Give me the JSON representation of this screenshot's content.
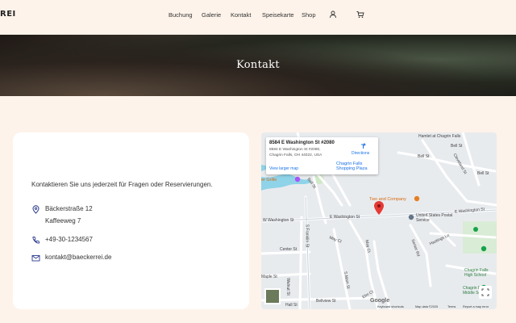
{
  "nav": {
    "brand": "REI",
    "items": [
      "Buchung",
      "Galerie",
      "Kontakt",
      "Speisekarte",
      "Shop"
    ],
    "user_icon": "user-icon",
    "cart_icon": "cart-icon"
  },
  "hero": {
    "title": "Kontakt"
  },
  "contact": {
    "intro": "Kontaktieren Sie uns jederzeit für Fragen oder Reservierungen.",
    "address_line1": "Bäckerstraße 12",
    "address_line2": "Kaffeeweg 7",
    "phone": "+49-30-1234567",
    "email": "kontakt@baeckerrei.de"
  },
  "map": {
    "info_title": "8584 E Washington St #2080",
    "info_addr1": "8584 E Washington St #2080,",
    "info_addr2": "Chagrin Falls, OH 44022, USA",
    "directions": "Directions",
    "view_larger": "View larger map",
    "labels": {
      "hamlet": "Hamlet at Chagrin Falls",
      "bell_st_top": "Bell St",
      "bell_st_right": "Bell St",
      "bell_st_left": "Bell St",
      "cleveland_st": "Cleveland St",
      "grille": "er Grille",
      "plaza": "Chagrin Falls Shopping Plaza",
      "two_and_company": "Two and Company",
      "w_washington": "W Washington St",
      "e_washington": "E Washington St",
      "e_washington_right": "E Washington St",
      "postal": "United States Postal Service",
      "hastings": "Hastings Ln",
      "center_st": "Center St",
      "franklin": "S Franklin St",
      "may_ct": "May Ct",
      "may_ct2": "May Ct",
      "maple": "Maple St",
      "walnut": "Walnut St",
      "main": "S Main St",
      "bellview": "Bellview St",
      "hall_st": "Hall St",
      "elm_ct": "Elm Ct",
      "senior_rd": "Senior Rd",
      "chagrin_hs": "Chagrin Falls High School",
      "chagrin_ms": "Chagrin Falls Middle School",
      "ch_f": "Chagrin Fal",
      "high_sc": "High Sc",
      "dream": "Dream",
      "chagrin_c": "Chagrin C",
      "middle_s": "Middle S"
    },
    "footer": {
      "keyboard": "Keyboard shortcuts",
      "mapdata": "Map data ©2025",
      "terms": "Terms",
      "report": "Report a map error"
    },
    "google": "Google",
    "colors": {
      "pin": "#e53935",
      "water": "#8fd3e8",
      "road": "#ffffff",
      "major_road": "#c9d2dc"
    }
  }
}
